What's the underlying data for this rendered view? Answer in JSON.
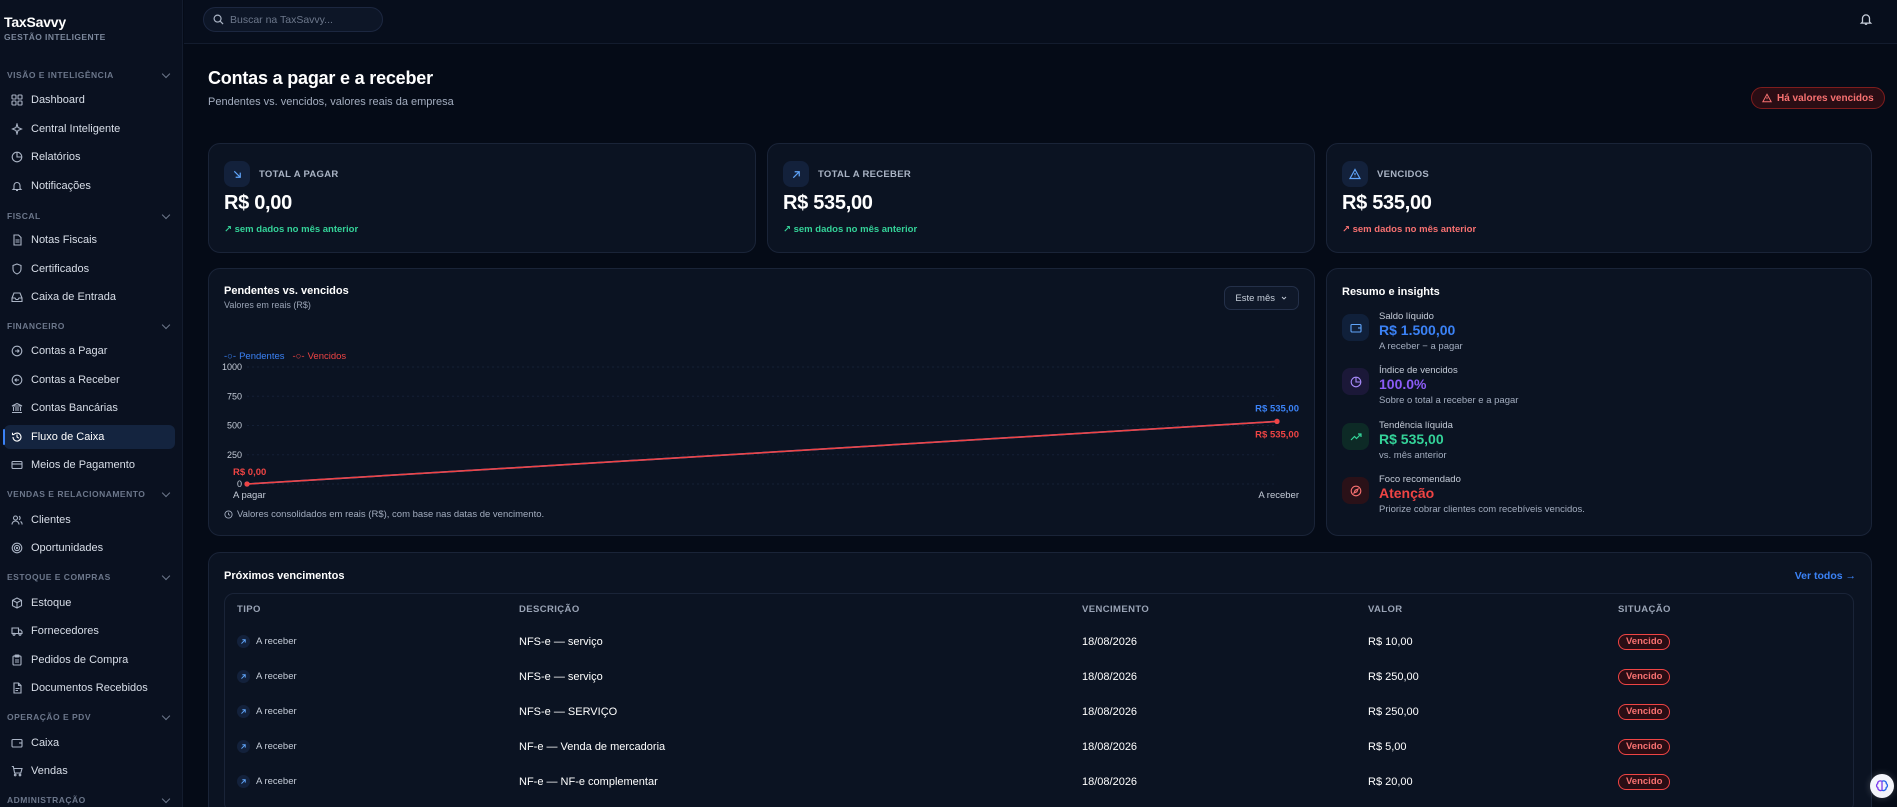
{
  "brand": {
    "name": "TaxSavvy",
    "subtitle": "GESTÃO INTELIGENTE"
  },
  "search": {
    "placeholder": "Buscar na TaxSavvy..."
  },
  "sidebar": {
    "sections": [
      {
        "title": "VISÃO E INTELIGÊNCIA"
      },
      {
        "title": "FISCAL"
      },
      {
        "title": "FINANCEIRO"
      },
      {
        "title": "VENDAS E RELACIONAMENTO"
      },
      {
        "title": "ESTOQUE E COMPRAS"
      },
      {
        "title": "OPERAÇÃO E PDV"
      },
      {
        "title": "ADMINISTRAÇÃO"
      }
    ],
    "items": [
      {
        "label": "Dashboard",
        "icon": "grid-icon"
      },
      {
        "label": "Central Inteligente",
        "icon": "sparkles-icon"
      },
      {
        "label": "Relatórios",
        "icon": "pie-chart-icon"
      },
      {
        "label": "Notificações",
        "icon": "bell-icon"
      },
      {
        "label": "Notas Fiscais",
        "icon": "file-icon"
      },
      {
        "label": "Certificados",
        "icon": "shield-icon"
      },
      {
        "label": "Caixa de Entrada",
        "icon": "inbox-icon"
      },
      {
        "label": "Contas a Pagar",
        "icon": "arrow-circle-icon"
      },
      {
        "label": "Contas a Receber",
        "icon": "arrow-circle-icon"
      },
      {
        "label": "Contas Bancárias",
        "icon": "bank-icon"
      },
      {
        "label": "Fluxo de Caixa",
        "icon": "history-icon",
        "active": true
      },
      {
        "label": "Meios de Pagamento",
        "icon": "credit-card-icon"
      },
      {
        "label": "Clientes",
        "icon": "users-icon"
      },
      {
        "label": "Oportunidades",
        "icon": "target-icon"
      },
      {
        "label": "Estoque",
        "icon": "box-icon"
      },
      {
        "label": "Fornecedores",
        "icon": "truck-icon"
      },
      {
        "label": "Pedidos de Compra",
        "icon": "clipboard-icon"
      },
      {
        "label": "Documentos Recebidos",
        "icon": "file-text-icon"
      },
      {
        "label": "Caixa",
        "icon": "wallet-icon"
      },
      {
        "label": "Vendas",
        "icon": "cart-icon"
      }
    ]
  },
  "header": {
    "title": "Contas a pagar e a receber",
    "subtitle": "Pendentes vs. vencidos, valores reais da empresa",
    "alert": "Há valores vencidos"
  },
  "kpis": [
    {
      "label": "TOTAL A PAGAR",
      "value": "R$ 0,00",
      "trend": "sem dados no mês anterior",
      "icon": "arrow-down-right-icon",
      "trend_color": "#34d399"
    },
    {
      "label": "TOTAL A RECEBER",
      "value": "R$ 535,00",
      "trend": "sem dados no mês anterior",
      "icon": "arrow-up-right-icon",
      "trend_color": "#34d399"
    },
    {
      "label": "VENCIDOS",
      "value": "R$ 535,00",
      "trend": "sem dados no mês anterior",
      "icon": "warning-icon",
      "trend_color": "#f87171"
    }
  ],
  "chart": {
    "title": "Pendentes vs. vencidos",
    "subtitle": "Valores em reais (R$)",
    "period": "Este mês",
    "footnote": "Valores consolidados em reais (R$), com base nas datas de vencimento."
  },
  "chart_data": {
    "type": "line",
    "categories": [
      "A pagar",
      "A receber"
    ],
    "series": [
      {
        "name": "Pendentes",
        "values": [
          0,
          535
        ],
        "color": "#3b82f6",
        "labels": [
          "R$ 0,00",
          "R$ 535,00"
        ]
      },
      {
        "name": "Vencidos",
        "values": [
          0,
          535
        ],
        "color": "#ef4444",
        "labels": [
          "R$ 0,00",
          "R$ 535,00"
        ]
      }
    ],
    "yticks": [
      "1000",
      "750",
      "500",
      "250",
      "0"
    ],
    "ylim": [
      0,
      1000
    ],
    "grid": true,
    "legend": "top-left"
  },
  "insights": {
    "title": "Resumo e insights",
    "items": [
      {
        "label": "Saldo líquido",
        "value": "R$ 1.500,00",
        "desc": "A receber − a pagar",
        "color": "#3b82f6",
        "icon": "wallet-icon"
      },
      {
        "label": "Índice de vencidos",
        "value": "100.0%",
        "desc": "Sobre o total a receber e a pagar",
        "color": "#8b5cf6",
        "icon": "pie-chart-icon"
      },
      {
        "label": "Tendência líquida",
        "value": "R$ 535,00",
        "desc": "vs. mês anterior",
        "color": "#34d399",
        "icon": "trending-up-icon"
      },
      {
        "label": "Foco recomendado",
        "value": "Atenção",
        "desc": "Priorize cobrar clientes com recebíveis vencidos.",
        "color": "#ef4444",
        "icon": "compass-icon"
      }
    ]
  },
  "upcoming": {
    "title": "Próximos vencimentos",
    "see_all": "Ver todos →",
    "columns": [
      "TIPO",
      "DESCRIÇÃO",
      "VENCIMENTO",
      "VALOR",
      "SITUAÇÃO"
    ],
    "rows": [
      {
        "tipo": "A receber",
        "descricao": "NFS-e — serviço",
        "vencimento": "18/08/2026",
        "valor": "R$ 10,00",
        "situacao": "Vencido"
      },
      {
        "tipo": "A receber",
        "descricao": "NFS-e — serviço",
        "vencimento": "18/08/2026",
        "valor": "R$ 250,00",
        "situacao": "Vencido"
      },
      {
        "tipo": "A receber",
        "descricao": "NFS-e — SERVIÇO",
        "vencimento": "18/08/2026",
        "valor": "R$ 250,00",
        "situacao": "Vencido"
      },
      {
        "tipo": "A receber",
        "descricao": "NF-e — Venda de mercadoria",
        "vencimento": "18/08/2026",
        "valor": "R$ 5,00",
        "situacao": "Vencido"
      },
      {
        "tipo": "A receber",
        "descricao": "NF-e — NF-e complementar",
        "vencimento": "18/08/2026",
        "valor": "R$ 20,00",
        "situacao": "Vencido"
      }
    ]
  }
}
